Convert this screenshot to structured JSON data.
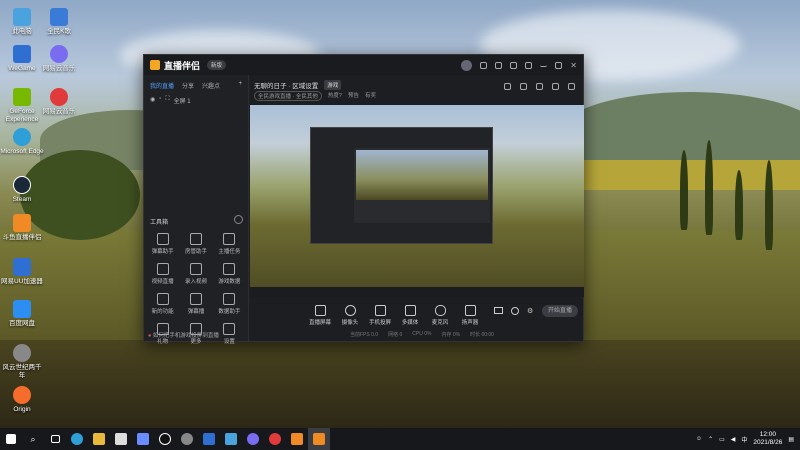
{
  "desktop": {
    "icons": [
      {
        "label": "此电脑",
        "color": "#4aa3df"
      },
      {
        "label": "全民K歌",
        "color": "#3b7bd8"
      },
      {
        "label": "WeGame",
        "color": "#2f6fd1"
      },
      {
        "label": "网易云音乐",
        "color": "#7a6cf0"
      },
      {
        "label": "GeForce Experience",
        "color": "#76b900"
      },
      {
        "label": "网易云音乐",
        "color": "#e03a3a"
      },
      {
        "label": "Microsoft Edge",
        "color": "#2f9fd8"
      },
      {
        "label": "Steam",
        "color": "#1b2838"
      },
      {
        "label": "斗鱼直播伴侣",
        "color": "#f08a24"
      },
      {
        "label": "网易UU加速器",
        "color": "#2f6fd1"
      },
      {
        "label": "百度网盘",
        "color": "#2b8ef0"
      },
      {
        "label": "风云世纪两千年",
        "color": "#888888"
      },
      {
        "label": "Origin",
        "color": "#f56c2d"
      }
    ]
  },
  "app": {
    "name": "直播伴侣",
    "badge": "新版",
    "tabs": [
      "我的直播",
      "分享",
      "兴趣点"
    ],
    "scene_label": "全屏 1",
    "tools_title": "工具箱",
    "tools": [
      "弹幕助手",
      "房管助手",
      "主播任务",
      "视频直播",
      "录入视频",
      "游戏数据",
      "新的功能",
      "弹幕播",
      "数据助手",
      "礼物",
      "更多",
      "设置"
    ],
    "footer_hint": "如何把手机游戏投屏到直播",
    "room_title": "无聊的日子 · 区域设置",
    "room_tag": "游戏",
    "room_sub": [
      "全民游戏直播 · 全民其他",
      "热度?",
      "预告",
      "有奖"
    ],
    "bottom_buttons": [
      "直播屏幕",
      "摄像头",
      "手机投屏",
      "多媒体",
      "麦克风",
      "扬声器"
    ],
    "go_live": "开始直播",
    "stats": [
      "当前FPS 0.0",
      "网络 0",
      "CPU 0%",
      "内存 0%",
      "时长 00:00"
    ]
  },
  "taskbar": {
    "time": "12:00",
    "date": "2021/8/26",
    "apps": [
      "#ffffff",
      "#4aa3df",
      "#dddddd",
      "#2f9fd8",
      "#e8b93b",
      "#6b8cff",
      "#111111",
      "#888888",
      "#2f6fd1",
      "#4aa3df",
      "#7a6cf0",
      "#e03a3a",
      "#f08a24",
      "#f08a24"
    ]
  }
}
